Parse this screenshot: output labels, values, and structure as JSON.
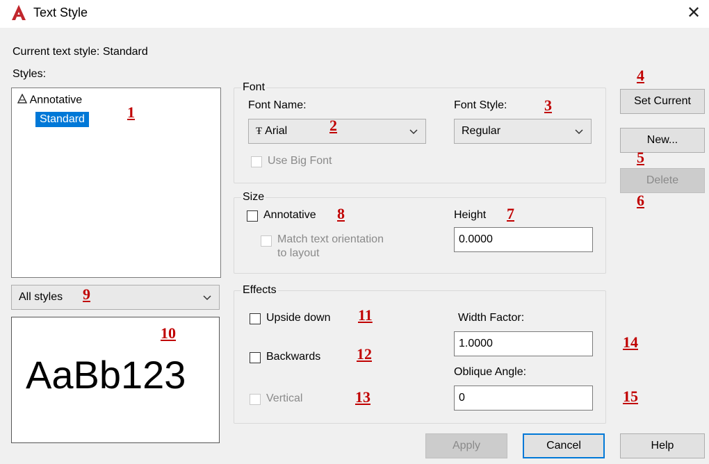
{
  "window": {
    "title": "Text Style",
    "close_glyph": "✕",
    "app_icon": "autocad-a-icon"
  },
  "current_style": {
    "label": "Current text style:",
    "value": "Standard"
  },
  "styles": {
    "label": "Styles:",
    "items": [
      {
        "label": "Annotative",
        "icon": "annotative-icon",
        "selected": false
      },
      {
        "label": "Standard",
        "selected": true
      }
    ],
    "filter": "All styles"
  },
  "preview": {
    "text": "AaBb123"
  },
  "font": {
    "group_label": "Font",
    "font_name_label": "Font Name:",
    "font_name_value": "Arial",
    "font_name_icon": "truetype-icon",
    "font_style_label": "Font Style:",
    "font_style_value": "Regular",
    "big_font_label": "Use Big Font"
  },
  "size": {
    "group_label": "Size",
    "annotative_label": "Annotative",
    "match_label_line1": "Match text orientation",
    "match_label_line2": "to layout",
    "height_label": "Height",
    "height_value": "0.0000"
  },
  "effects": {
    "group_label": "Effects",
    "upside_down_label": "Upside down",
    "backwards_label": "Backwards",
    "vertical_label": "Vertical",
    "width_factor_label": "Width Factor:",
    "width_factor_value": "1.0000",
    "oblique_label": "Oblique Angle:",
    "oblique_value": "0"
  },
  "buttons": {
    "set_current": "Set Current",
    "new": "New...",
    "delete": "Delete",
    "apply": "Apply",
    "cancel": "Cancel",
    "help": "Help"
  },
  "callouts": [
    "1",
    "2",
    "3",
    "4",
    "5",
    "6",
    "7",
    "8",
    "9",
    "10",
    "11",
    "12",
    "13",
    "14",
    "15"
  ],
  "colors": {
    "accent": "#0078d7",
    "callout": "#c00000",
    "brand": "#c1272d"
  }
}
